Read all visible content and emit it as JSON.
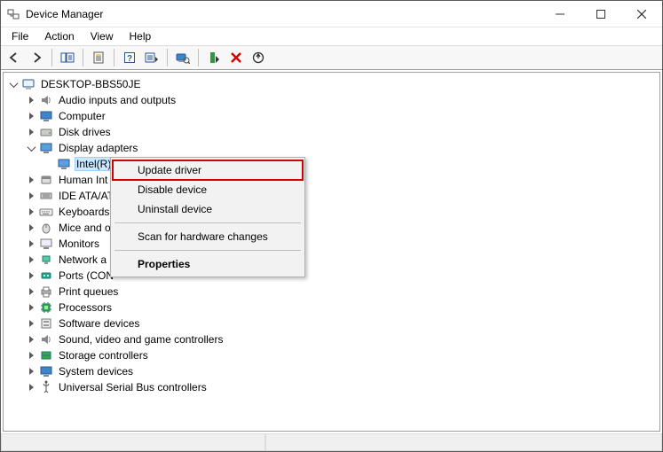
{
  "window": {
    "title": "Device Manager"
  },
  "menubar": {
    "file": "File",
    "action": "Action",
    "view": "View",
    "help": "Help"
  },
  "tree": {
    "root": "DESKTOP-BBS50JE",
    "audio": "Audio inputs and outputs",
    "computer": "Computer",
    "disk": "Disk drives",
    "display": "Display adapters",
    "display_child": "Intel(R) HD Graphics 4600",
    "hid": "Human Int",
    "ide": "IDE ATA/AT",
    "keyboards": "Keyboards",
    "mice": "Mice and o",
    "monitors": "Monitors",
    "network": "Network a",
    "ports": "Ports (CON",
    "printq": "Print queues",
    "processors": "Processors",
    "software": "Software devices",
    "sound": "Sound, video and game controllers",
    "storage": "Storage controllers",
    "system": "System devices",
    "usb": "Universal Serial Bus controllers"
  },
  "context_menu": {
    "update": "Update driver",
    "disable": "Disable device",
    "uninstall": "Uninstall device",
    "scan": "Scan for hardware changes",
    "properties": "Properties"
  }
}
